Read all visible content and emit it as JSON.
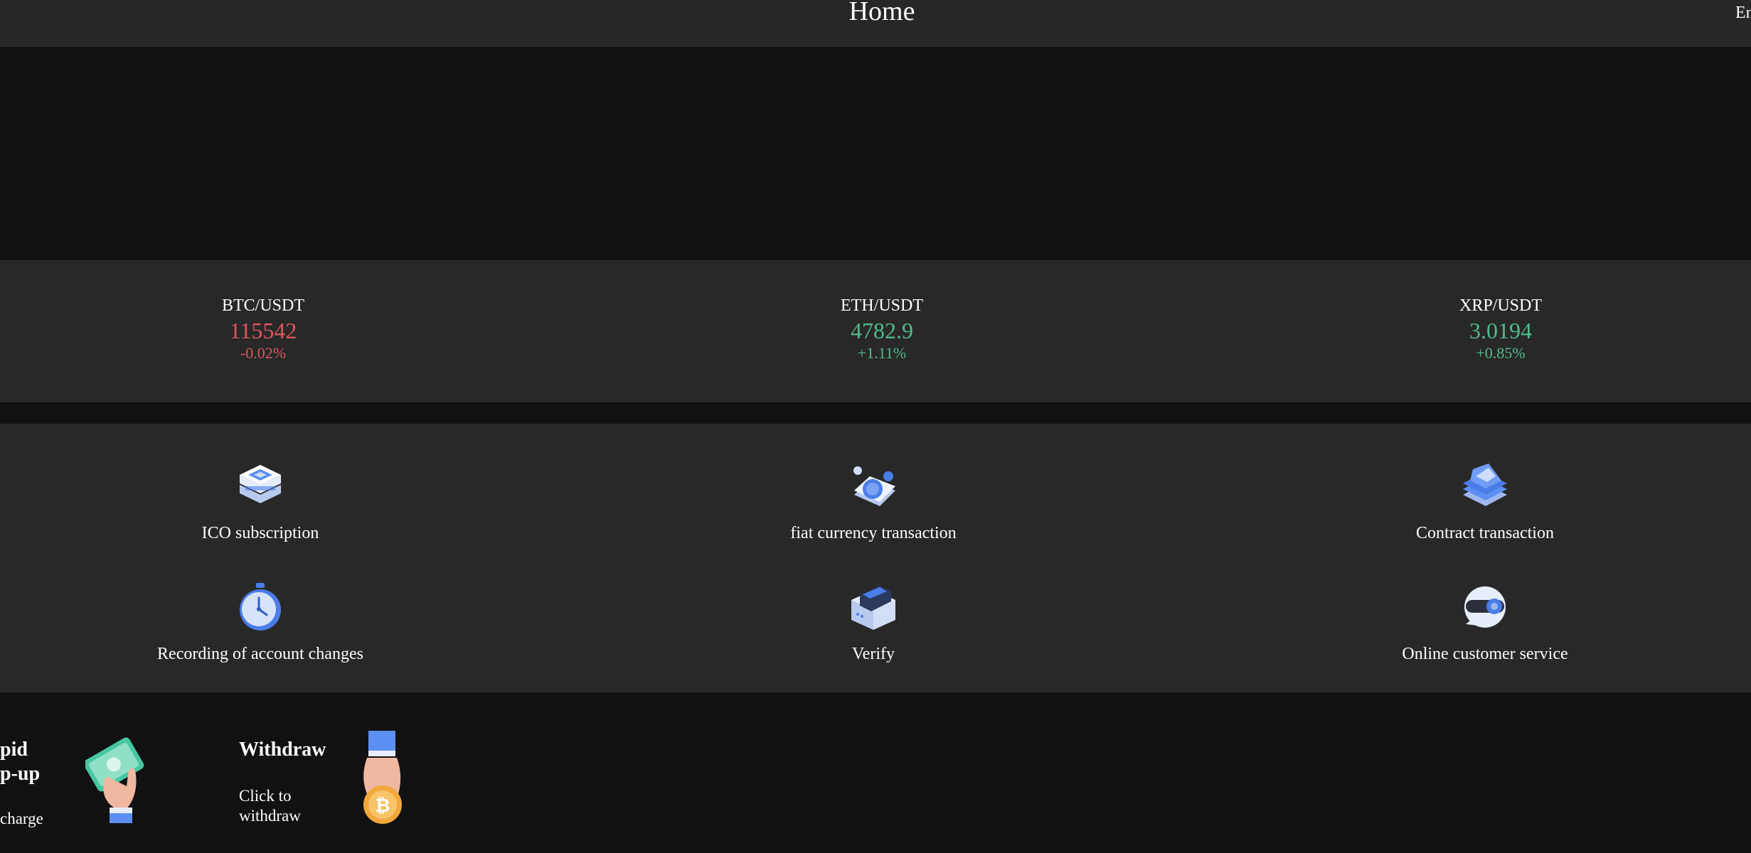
{
  "header": {
    "title": "Home",
    "language": "En"
  },
  "ticker": [
    {
      "pair": "BTC/USDT",
      "price": "115542",
      "change": "-0.02%",
      "trend": "down"
    },
    {
      "pair": "ETH/USDT",
      "price": "4782.9",
      "change": "+1.11%",
      "trend": "up"
    },
    {
      "pair": "XRP/USDT",
      "price": "3.0194",
      "change": "+0.85%",
      "trend": "up"
    }
  ],
  "features": [
    {
      "label": "ICO subscription",
      "icon": "ico-chip-icon"
    },
    {
      "label": "fiat currency transaction",
      "icon": "fiat-coin-icon"
    },
    {
      "label": "Contract transaction",
      "icon": "contract-book-icon"
    },
    {
      "label": "Recording of account changes",
      "icon": "stopwatch-icon"
    },
    {
      "label": "Verify",
      "icon": "verify-box-icon"
    },
    {
      "label": "Online customer service",
      "icon": "headset-icon"
    }
  ],
  "actions": {
    "topup": {
      "title_line1": "pid",
      "title_line2": "p-up",
      "text": "charge",
      "icon": "cash-hand-icon"
    },
    "withdraw": {
      "title": "Withdraw",
      "text_line1": "Click to",
      "text_line2": "withdraw",
      "icon": "bitcoin-hand-icon"
    }
  },
  "colors": {
    "up": "#4fbb8a",
    "down": "#e05560",
    "accent": "#3d7ef0",
    "panel": "#282828",
    "background": "#111111"
  }
}
